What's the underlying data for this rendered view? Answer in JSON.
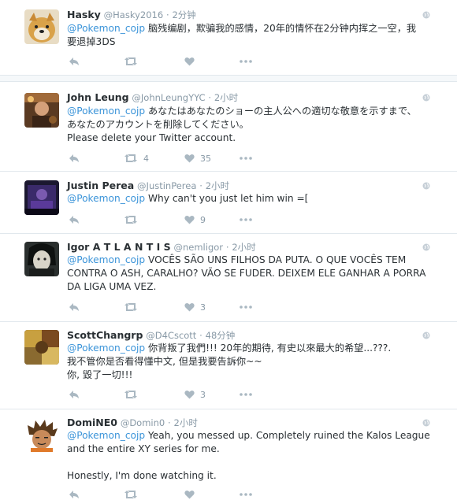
{
  "tweets": [
    {
      "name": "Hasky",
      "handle": "@Hasky2016",
      "time": "2分钟",
      "mention": "@Pokemon_cojp",
      "lines": [
        "脑残编剧，欺骗我的感情，20年的情怀在2分钟内挥之一空，我",
        "要退掉3DS"
      ],
      "retweets": "",
      "likes": ""
    },
    {
      "name": "John Leung",
      "handle": "@JohnLeungYYC",
      "time": "2小时",
      "mention": "@Pokemon_cojp",
      "lines": [
        "あなたはあなたのショーの主人公への適切な敬意を示すまで、",
        "あなたのアカウントを削除してください。",
        "Please delete your Twitter account."
      ],
      "retweets": "4",
      "likes": "35"
    },
    {
      "name": "Justin Perea",
      "handle": "@JustinPerea",
      "time": "2小时",
      "mention": "@Pokemon_cojp",
      "lines": [
        "Why can't you just let him win =["
      ],
      "retweets": "",
      "likes": "9"
    },
    {
      "name": "Igor A T L A N T I S",
      "handle": "@nemligor",
      "time": "2小时",
      "mention": "@Pokemon_cojp",
      "lines": [
        "VOCÊS SÃO UNS FILHOS DA PUTA. O QUE VOCÊS TEM",
        "CONTRA O ASH, CARALHO? VÃO SE FUDER. DEIXEM ELE GANHAR A PORRA",
        "DA LIGA UMA VEZ."
      ],
      "retweets": "",
      "likes": "3"
    },
    {
      "name": "ScottChangrp",
      "handle": "@D4Cscott",
      "time": "48分钟",
      "mention": "@Pokemon_cojp",
      "lines": [
        "你背叛了我們!!! 20年的期待, 有史以來最大的希望...???.",
        "我不管你是否看得懂中文, 但是我要告訴你~~",
        "你, 毀了一切!!!"
      ],
      "retweets": "",
      "likes": "3"
    },
    {
      "name": "DomiNE0",
      "handle": "@Domin0",
      "time": "2小时",
      "mention": "@Pokemon_cojp",
      "lines": [
        "Yeah, you messed up. Completely ruined the Kalos League",
        "and the entire XY series for me.",
        "",
        "Honestly, I'm done watching it."
      ],
      "retweets": "",
      "likes": ""
    }
  ],
  "separator_dot": "·",
  "colors": {
    "accent": "#3b94d9",
    "muted": "#8899a6",
    "text": "#292f33",
    "border": "#e1e8ed"
  },
  "icons": [
    "reply-icon",
    "retweet-icon",
    "like-icon",
    "more-icon",
    "globe-icon"
  ]
}
